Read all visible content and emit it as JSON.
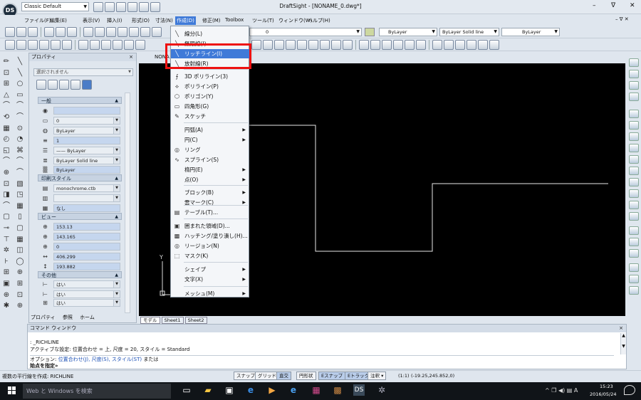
{
  "title_bar": {
    "workspace": "Classic Default",
    "title": "DraftSight - [NONAME_0.dwg*]",
    "minimize": "–",
    "maximize": "ᐁ",
    "close": "✕"
  },
  "menubar": {
    "items": [
      "ファイル(F)",
      "編集(E)",
      "表示(V)",
      "挿入(I)",
      "形式(O)",
      "寸法(N)",
      "作成(D)",
      "修正(M)",
      "Toolbox",
      "ツール(T)",
      "ウィンドウ(W)",
      "ヘルプ(H)"
    ],
    "doc_controls": "– ᐁ ✕"
  },
  "toolbar": {
    "layer_value": "0",
    "color_value": "ByLayer",
    "linestyle_value": "ByLayer   Solid line",
    "lineweight_value": "ByLayer"
  },
  "properties_panel": {
    "title": "プロパティ",
    "close": "×",
    "selection_label": "選択されません",
    "sections": {
      "general": "一般",
      "print_style": "印刷スタイル",
      "view": "ビュー",
      "other": "その他"
    },
    "general_values": [
      "",
      "0",
      "ByLayer",
      "1",
      "—— ByLayer",
      "ByLayer    Solid line",
      "ByLayer"
    ],
    "print_values": [
      "monochrome.ctb",
      "",
      "なし"
    ],
    "view_values": [
      "153.13",
      "143.165",
      "0",
      "406.299",
      "193.882"
    ],
    "other_values": [
      "はい",
      "はい",
      "はい"
    ],
    "tabs": [
      "プロパティ",
      "参照",
      "ホーム"
    ]
  },
  "drawing_tab": "NONA",
  "layout_tabs": [
    "モデル",
    "Sheet1",
    "Sheet2"
  ],
  "ucs_label": "Y",
  "create_menu": {
    "items": [
      {
        "label": "線分(L)",
        "icon": "line-icon",
        "glyph": "╲",
        "sub": false
      },
      {
        "label": "無限線(I)",
        "icon": "infinite-line-icon",
        "glyph": "╲",
        "sub": false
      },
      {
        "label": "リッチライン(I)",
        "icon": "richline-icon",
        "glyph": "╲",
        "sub": false,
        "highlight": true
      },
      {
        "label": "放射線(R)",
        "icon": "ray-icon",
        "glyph": "╲",
        "sub": false
      },
      {
        "label": "3D ポリライン(3)",
        "icon": "polyline-3d-icon",
        "glyph": "⨍",
        "sub": false
      },
      {
        "label": "ポリライン(P)",
        "icon": "polyline-icon",
        "glyph": "⟡",
        "sub": false
      },
      {
        "label": "ポリゴン(Y)",
        "icon": "polygon-icon",
        "glyph": "⬡",
        "sub": false
      },
      {
        "label": "四角形(G)",
        "icon": "rectangle-icon",
        "glyph": "▭",
        "sub": false
      },
      {
        "label": "スケッチ",
        "icon": "sketch-icon",
        "glyph": "✎",
        "sub": false
      },
      {
        "label": "円弧(A)",
        "icon": "arc-icon",
        "glyph": "",
        "sub": true
      },
      {
        "label": "円(C)",
        "icon": "circle-icon",
        "glyph": "",
        "sub": true
      },
      {
        "label": "リング",
        "icon": "ring-icon",
        "glyph": "◎",
        "sub": false
      },
      {
        "label": "スプライン(S)",
        "icon": "spline-icon",
        "glyph": "∿",
        "sub": false
      },
      {
        "label": "楕円(E)",
        "icon": "ellipse-icon",
        "glyph": "",
        "sub": true
      },
      {
        "label": "点(O)",
        "icon": "point-icon",
        "glyph": "",
        "sub": true
      },
      {
        "label": "ブロック(B)",
        "icon": "block-icon",
        "glyph": "",
        "sub": true
      },
      {
        "label": "雲マーク(C)",
        "icon": "cloud-icon",
        "glyph": "",
        "sub": true
      },
      {
        "label": "テーブル(T)...",
        "icon": "table-icon",
        "glyph": "▤",
        "sub": false
      },
      {
        "label": "囲まれた領域(D)...",
        "icon": "boundary-icon",
        "glyph": "▣",
        "sub": false
      },
      {
        "label": "ハッチング/塗り潰し(H)...",
        "icon": "hatch-icon",
        "glyph": "▩",
        "sub": false
      },
      {
        "label": "リージョン(N)",
        "icon": "region-icon",
        "glyph": "◎",
        "sub": false
      },
      {
        "label": "マスク(K)",
        "icon": "mask-icon",
        "glyph": "⬚",
        "sub": false
      },
      {
        "label": "シェイプ",
        "icon": "shape-icon",
        "glyph": "",
        "sub": true
      },
      {
        "label": "文字(X)",
        "icon": "text-icon",
        "glyph": "",
        "sub": true
      },
      {
        "label": "メッシュ(M)",
        "icon": "mesh-icon",
        "glyph": "",
        "sub": true
      }
    ]
  },
  "command_window": {
    "title": "コマンド ウィンドウ",
    "close": "×",
    "history": [
      ": _RICHLINE",
      "アクティブな設定: 位置合わせ = 上, 尺度 = 20, スタイル = Standard"
    ],
    "options_prefix": "オプション: ",
    "options_links": "位置合わせ(J), 尺度(S), スタイル(ST)",
    "options_suffix": " または",
    "prompt": "始点を指定»"
  },
  "status_bar": {
    "message": "複数の平行線を作成: RICHLINE",
    "buttons": [
      {
        "label": "スナップ",
        "on": false
      },
      {
        "label": "グリッド",
        "on": false
      },
      {
        "label": "直交",
        "on": true
      },
      {
        "label": "円形状",
        "on": false
      },
      {
        "label": "Eスナップ",
        "on": true
      },
      {
        "label": "Eトラック",
        "on": true
      },
      {
        "label": "注釈 ▾",
        "on": false
      }
    ],
    "scale": "(1:1)",
    "coords": "(-19.25,245.852,0)"
  },
  "taskbar": {
    "search_placeholder": "Web と Windows を検索",
    "tray": "^ ❐ ◀) ▤ A",
    "time": "15:23",
    "date": "2016/05/24"
  }
}
